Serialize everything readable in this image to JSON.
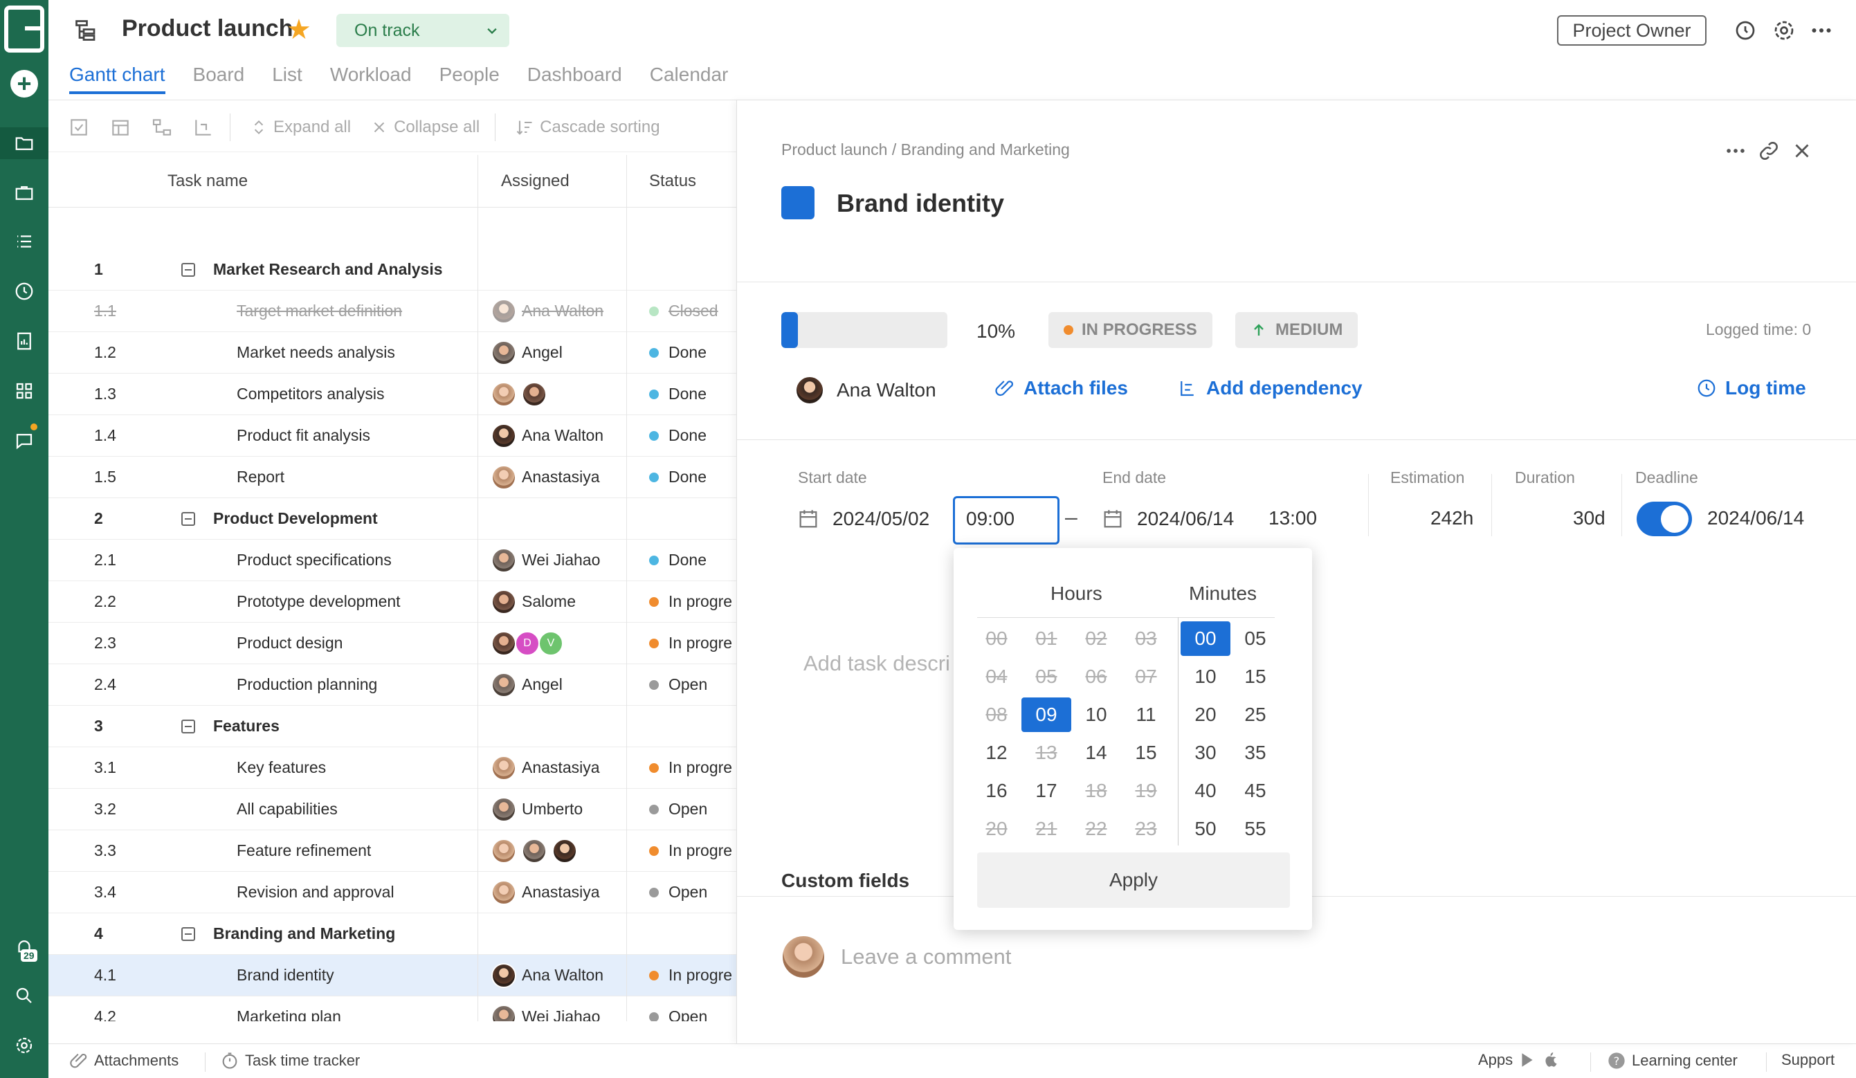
{
  "project": {
    "title": "Product launch",
    "status": "On track",
    "role": "Project Owner"
  },
  "tabs": [
    "Gantt chart",
    "Board",
    "List",
    "Workload",
    "People",
    "Dashboard",
    "Calendar"
  ],
  "toolbar": {
    "expand_all": "Expand all",
    "collapse_all": "Collapse all",
    "cascade_sorting": "Cascade sorting"
  },
  "grid": {
    "headers": {
      "task_name": "Task name",
      "assigned": "Assigned",
      "status": "Status"
    },
    "rows": [
      {
        "num": "1",
        "name": "Market Research and Analysis",
        "group": true
      },
      {
        "num": "1.1",
        "name": "Target market definition",
        "assigned": "Ana Walton",
        "status": "Closed",
        "closed": true
      },
      {
        "num": "1.2",
        "name": "Market needs analysis",
        "assigned": "Angel",
        "status": "Done"
      },
      {
        "num": "1.3",
        "name": "Competitors analysis",
        "assigned": "",
        "status": "Done"
      },
      {
        "num": "1.4",
        "name": "Product fit analysis",
        "assigned": "Ana Walton",
        "status": "Done"
      },
      {
        "num": "1.5",
        "name": "Report",
        "assigned": "Anastasiya",
        "status": "Done"
      },
      {
        "num": "2",
        "name": "Product Development",
        "group": true
      },
      {
        "num": "2.1",
        "name": "Product specifications",
        "assigned": "Wei Jiahao",
        "status": "Done"
      },
      {
        "num": "2.2",
        "name": "Prototype development",
        "assigned": "Salome",
        "status": "In progre"
      },
      {
        "num": "2.3",
        "name": "Product design",
        "assigned": "",
        "status": "In progre",
        "letters": [
          "D",
          "V"
        ]
      },
      {
        "num": "2.4",
        "name": "Production planning",
        "assigned": "Angel",
        "status": "Open"
      },
      {
        "num": "3",
        "name": "Features",
        "group": true
      },
      {
        "num": "3.1",
        "name": "Key features",
        "assigned": "Anastasiya",
        "status": "In progre"
      },
      {
        "num": "3.2",
        "name": "All capabilities",
        "assigned": "Umberto",
        "status": "Open"
      },
      {
        "num": "3.3",
        "name": "Feature refinement",
        "assigned": "",
        "status": "In progre"
      },
      {
        "num": "3.4",
        "name": "Revision and approval",
        "assigned": "Anastasiya",
        "status": "Open"
      },
      {
        "num": "4",
        "name": "Branding and Marketing",
        "group": true
      },
      {
        "num": "4.1",
        "name": "Brand identity",
        "assigned": "Ana Walton",
        "status": "In progre",
        "selected": true
      },
      {
        "num": "4.2",
        "name": "Marketing plan",
        "assigned": "Wei Jiahao",
        "status": "Open"
      }
    ]
  },
  "status_colors": {
    "Done": "#4db6e2",
    "In progre": "#f08c2e",
    "Open": "#9a9a9a",
    "Closed": "#b8e6c4"
  },
  "panel": {
    "breadcrumb": "Product launch / Branding and Marketing",
    "task_title": "Brand identity",
    "progress": 10,
    "progress_label": "10%",
    "status": "IN PROGRESS",
    "priority": "MEDIUM",
    "logged_time": "Logged time: 0",
    "assignee": "Ana Walton",
    "attach_files": "Attach files",
    "add_dependency": "Add dependency",
    "log_time": "Log time",
    "start_date_label": "Start date",
    "start_date": "2024/05/02",
    "start_time": "09:00",
    "end_date_label": "End date",
    "end_date": "2024/06/14",
    "end_time": "13:00",
    "estimation_label": "Estimation",
    "estimation": "242h",
    "duration_label": "Duration",
    "duration": "30d",
    "deadline_label": "Deadline",
    "deadline": "2024/06/14",
    "description_placeholder": "Add task descri",
    "custom_fields": "Custom fields",
    "comment_placeholder": "Leave a comment"
  },
  "time_picker": {
    "hours_label": "Hours",
    "minutes_label": "Minutes",
    "hours": [
      [
        "00",
        "01",
        "02",
        "03"
      ],
      [
        "04",
        "05",
        "06",
        "07"
      ],
      [
        "08",
        "09",
        "10",
        "11"
      ],
      [
        "12",
        "13",
        "14",
        "15"
      ],
      [
        "16",
        "17",
        "18",
        "19"
      ],
      [
        "20",
        "21",
        "22",
        "23"
      ]
    ],
    "disabled_hours": [
      "00",
      "01",
      "02",
      "03",
      "04",
      "05",
      "06",
      "07",
      "08",
      "13",
      "18",
      "19",
      "20",
      "21",
      "22",
      "23"
    ],
    "selected_hour": "09",
    "minutes": [
      [
        "00",
        "05"
      ],
      [
        "10",
        "15"
      ],
      [
        "20",
        "25"
      ],
      [
        "30",
        "35"
      ],
      [
        "40",
        "45"
      ],
      [
        "50",
        "55"
      ]
    ],
    "selected_minute": "00",
    "apply": "Apply"
  },
  "bottom": {
    "attachments": "Attachments",
    "time_tracker": "Task time tracker",
    "apps": "Apps",
    "learning_center": "Learning center",
    "support": "Support"
  },
  "notifications_count": "29"
}
